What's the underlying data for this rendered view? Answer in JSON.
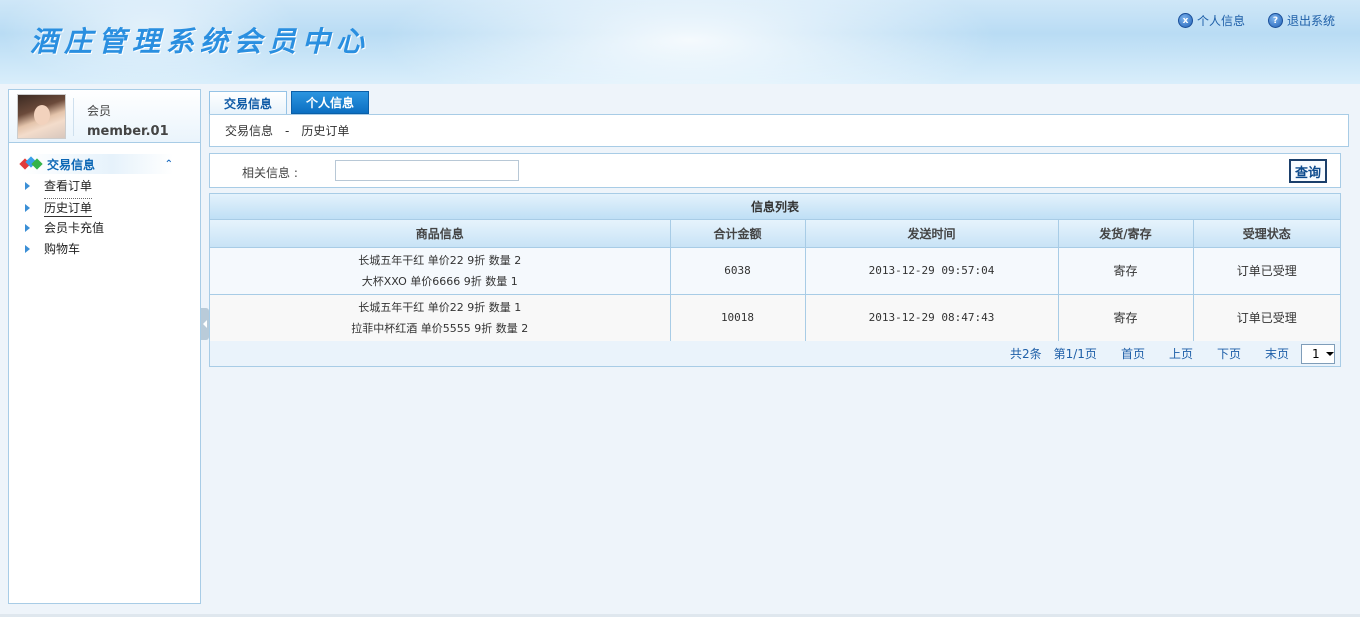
{
  "header": {
    "app_title": "酒庄管理系统会员中心",
    "links": [
      {
        "label": "个人信息",
        "icon": "close-circle-icon",
        "glyph": "x"
      },
      {
        "label": "退出系统",
        "icon": "help-circle-icon",
        "glyph": "?"
      }
    ]
  },
  "sidebar": {
    "user": {
      "role": "会员",
      "name": "member.01"
    },
    "menu_header": "交易信息",
    "items": [
      {
        "label": "查看订单"
      },
      {
        "label": "历史订单",
        "active": true
      },
      {
        "label": "会员卡充值"
      },
      {
        "label": "购物车"
      }
    ]
  },
  "tabs": [
    {
      "label": "交易信息"
    },
    {
      "label": "个人信息"
    }
  ],
  "breadcrumb": {
    "part1": "交易信息",
    "sep": "-",
    "part2": "历史订单"
  },
  "search": {
    "label": "相关信息 :",
    "value": "",
    "button": "查询"
  },
  "table": {
    "title": "信息列表",
    "columns": [
      "商品信息",
      "合计金额",
      "发送时间",
      "发货/寄存",
      "受理状态"
    ],
    "rows": [
      {
        "goods": [
          "长城五年干红   单价22   9折    数量 2",
          "大杯XXO   单价6666   9折    数量 1"
        ],
        "total": "6038",
        "time": "2013-12-29 09:57:04",
        "delivery": "寄存",
        "status": "订单已受理"
      },
      {
        "goods": [
          "长城五年干红   单价22   9折    数量 1",
          "拉菲中杯红酒   单价5555   9折    数量 2"
        ],
        "total": "10018",
        "time": "2013-12-29 08:47:43",
        "delivery": "寄存",
        "status": "订单已受理"
      }
    ]
  },
  "pager": {
    "total": "共2条",
    "page": "第1/1页",
    "first": "首页",
    "prev": "上页",
    "next": "下页",
    "last": "末页",
    "selected": "1"
  },
  "colors": {
    "accent": "#0c6fc2",
    "border": "#a8cce6",
    "title": "#2a8fe0"
  }
}
